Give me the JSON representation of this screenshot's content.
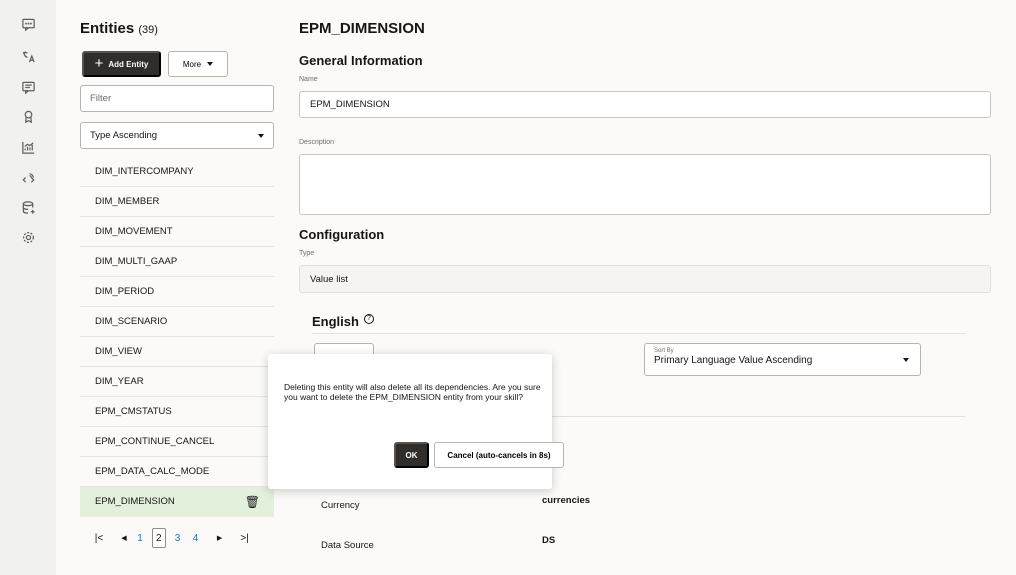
{
  "left_panel": {
    "title": "Entities",
    "count": "(39)",
    "add_entity_label": "Add Entity",
    "more_label": "More",
    "filter_placeholder": "Filter",
    "sort_value": "Type Ascending",
    "entities": [
      "DIM_INTERCOMPANY",
      "DIM_MEMBER",
      "DIM_MOVEMENT",
      "DIM_MULTI_GAAP",
      "DIM_PERIOD",
      "DIM_SCENARIO",
      "DIM_VIEW",
      "DIM_YEAR",
      "EPM_CMSTATUS",
      "EPM_CONTINUE_CANCEL",
      "EPM_DATA_CALC_MODE",
      "EPM_DIMENSION"
    ],
    "selected_entity": "EPM_DIMENSION",
    "pagination": {
      "pages": [
        "1",
        "2",
        "3",
        "4"
      ],
      "current_page": "2"
    }
  },
  "detail": {
    "title": "EPM_DIMENSION",
    "general_heading": "General Information",
    "name_label": "Name",
    "name_value": "EPM_DIMENSION",
    "description_label": "Description",
    "description_value": "",
    "configuration_heading": "Configuration",
    "type_label": "Type",
    "type_value": "Value list",
    "language_heading": "English",
    "sort_by_label": "Sort By",
    "sort_by_value": "Primary Language Value Ascending",
    "properties": [
      {
        "key": "Currency",
        "value": "currencies"
      },
      {
        "key": "Data Source",
        "value": "DS"
      }
    ]
  },
  "dialog": {
    "message": "Deleting this entity will also delete all its dependencies. Are you sure you want to delete the EPM_DIMENSION entity from your skill?",
    "ok_label": "OK",
    "cancel_label": "Cancel (auto-cancels in 8s)"
  },
  "icons": {
    "rail": [
      "chat-icon",
      "translate-icon",
      "message-list-icon",
      "badge-icon",
      "analytics-icon",
      "api-icon",
      "database-icon",
      "settings-icon"
    ],
    "add": "plus-icon",
    "delete": "trash-icon",
    "help": "help-icon"
  },
  "colors": {
    "primary_button": "#312d2a",
    "selected_row": "#e3f0dc",
    "page_link": "#1e6fa8",
    "panel_background": "#fbfaf8"
  }
}
